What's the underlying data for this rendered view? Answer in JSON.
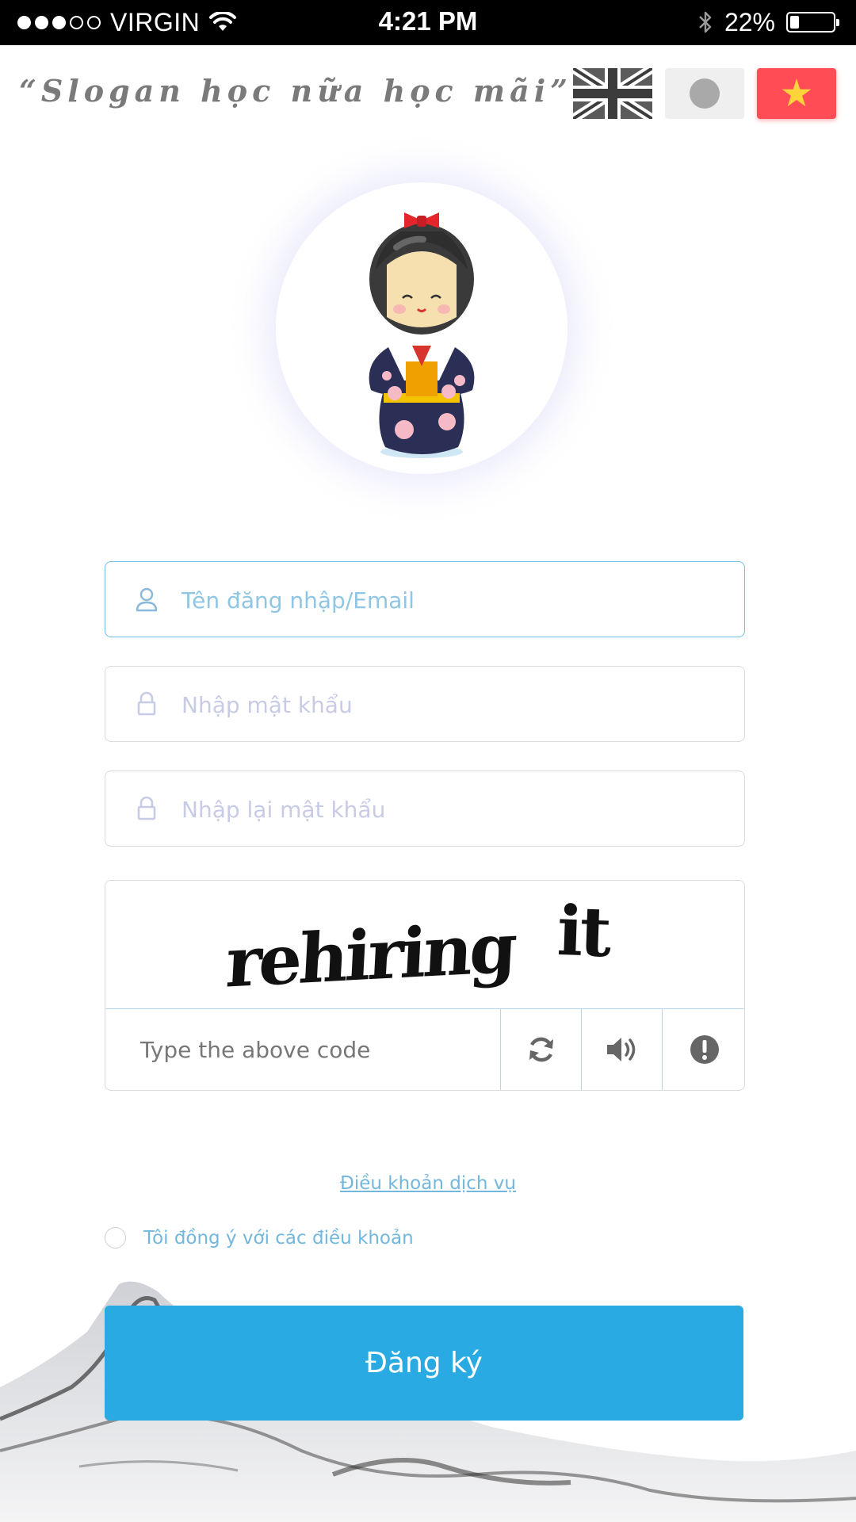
{
  "status_bar": {
    "carrier": "VIRGIN",
    "time": "4:21 PM",
    "battery_percent": "22%",
    "battery_level": 0.22,
    "signal_bars_filled": 3,
    "signal_bars_total": 5
  },
  "header": {
    "slogan": "“Slogan học nữa học mãi”",
    "languages": [
      {
        "name": "English",
        "icon": "uk-flag-icon"
      },
      {
        "name": "Gray option",
        "icon": "gray-circle-icon"
      },
      {
        "name": "Vietnamese",
        "icon": "vietnam-flag-icon",
        "selected": true
      }
    ]
  },
  "form": {
    "username_placeholder": "Tên đăng nhập/Email",
    "password_placeholder": "Nhập mật khẩu",
    "confirm_password_placeholder": "Nhập lại mật khẩu",
    "captcha_word_1": "rehiring",
    "captcha_word_2": "it",
    "captcha_placeholder": "Type the above code",
    "terms_link": "Điều khoản dịch vụ",
    "agree_label": "Tôi đồng ý với các điều khoản",
    "submit_label": "Đăng ký"
  },
  "colors": {
    "accent": "#2aaae3",
    "link": "#73b7dd",
    "active_border": "#6ec1e4",
    "flag_red": "#ff4c55",
    "flag_star": "#ffd43a"
  }
}
